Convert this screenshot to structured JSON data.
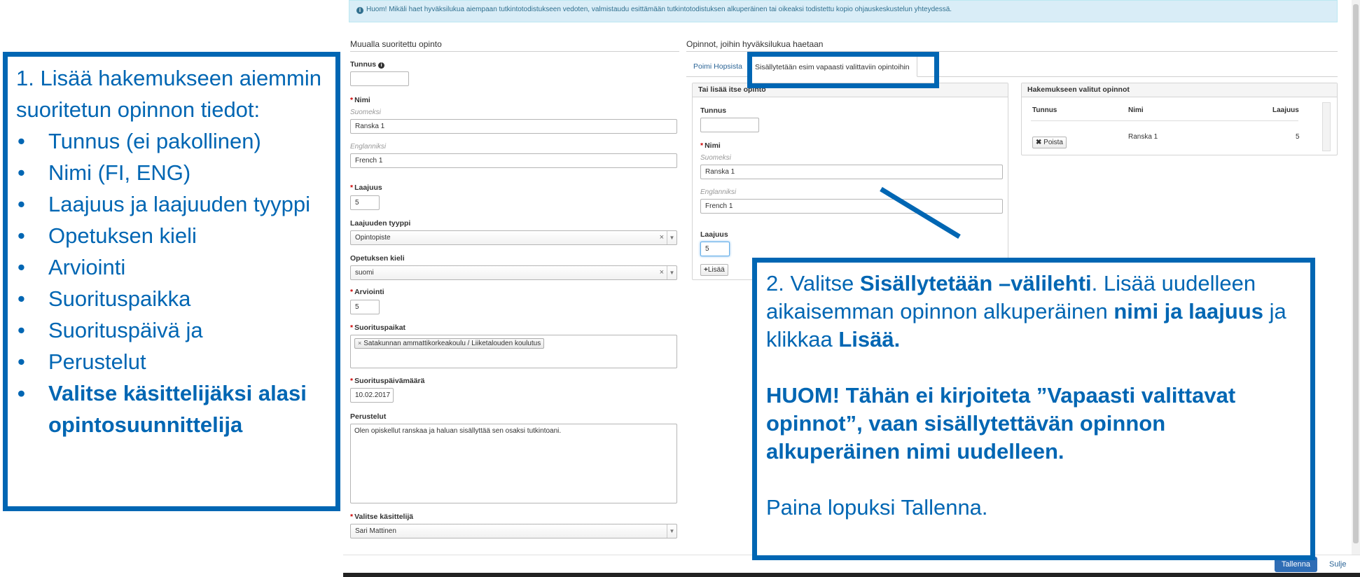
{
  "notice": {
    "icon": "info-circle-icon",
    "text": "Huom! Mikäli haet hyväksilukua aiempaan tutkintotodistukseen vedoten, valmistaudu esittämään tutkintotodistuksen alkuperäinen tai oikeaksi todistettu kopio ohjauskeskustelun yhteydessä."
  },
  "left_form": {
    "title": "Muualla suoritettu opinto",
    "tunnus_label": "Tunnus",
    "tunnus_value": "",
    "nimi_label": "Nimi",
    "suomeksi_label": "Suomeksi",
    "nimi_fi": "Ranska 1",
    "englanniksi_label": "Englanniksi",
    "nimi_en": "French 1",
    "laajuus_label": "Laajuus",
    "laajuus_value": "5",
    "laajuuden_tyyppi_label": "Laajuuden tyyppi",
    "laajuuden_tyyppi_value": "Opintopiste",
    "opetuksen_kieli_label": "Opetuksen kieli",
    "opetuksen_kieli_value": "suomi",
    "arviointi_label": "Arviointi",
    "arviointi_value": "5",
    "suorituspaikat_label": "Suorituspaikat",
    "suorituspaikka_chip": "Satakunnan ammattikorkeakoulu / Liiketalouden koulutus",
    "suorituspaivamaara_label": "Suorituspäivämäärä",
    "suorituspaivamaara_value": "10.02.2017",
    "perustelut_label": "Perustelut",
    "perustelut_value": "Olen opiskellut ranskaa ja haluan sisällyttää sen osaksi tutkintoani.",
    "kasittelija_label": "Valitse käsittelijä",
    "kasittelija_value": "Sari Mattinen",
    "required_mark": "*",
    "clear_mark": "×",
    "caret": "▼"
  },
  "right_area": {
    "title": "Opinnot, joihin hyväksilukua haetaan",
    "tabs": [
      {
        "label": "Poimi Hopsista",
        "active": false
      },
      {
        "label": "Sisällytetään esim vapaasti valittaviin opintoihin",
        "active": true
      }
    ],
    "own_panel": {
      "title": "Tai lisää itse opinto",
      "tunnus_label": "Tunnus",
      "tunnus_value": "",
      "nimi_label": "Nimi",
      "suomeksi_label": "Suomeksi",
      "nimi_fi": "Ranska 1",
      "englanniksi_label": "Englanniksi",
      "nimi_en": "French 1",
      "laajuus_label": "Laajuus",
      "laajuus_value": "5",
      "add_button": "Lisää",
      "add_icon": "plus-icon"
    },
    "selected_panel": {
      "title": "Hakemukseen valitut opinnot",
      "columns": [
        "Tunnus",
        "Nimi",
        "Laajuus"
      ],
      "rows": [
        {
          "tunnus": "",
          "nimi": "Ranska 1",
          "laajuus": "5",
          "remove_label": "Poista"
        }
      ]
    }
  },
  "footer": {
    "save_label": "Tallenna",
    "close_label": "Sulje"
  },
  "callout1": {
    "intro": "1. Lisää hakemukseen aiemmin suoritetun opinnon tiedot:",
    "items": [
      "Tunnus (ei  pakollinen)",
      "Nimi (FI, ENG)",
      "Laajuus ja laajuuden tyyppi",
      "Opetuksen kieli",
      "Arviointi",
      "Suorituspaikka",
      "Suorituspäivä ja",
      "Perustelut"
    ],
    "last_item": "Valitse käsittelijäksi alasi opintosuunnittelija"
  },
  "callout2": {
    "p1_a": "2. Valitse ",
    "p1_b": "Sisällytetään –välilehti",
    "p1_c": ". Lisää uudelleen aikaisemman opinnon alkuperäinen ",
    "p1_d": "nimi ja laajuus",
    "p1_e": " ja klikkaa ",
    "p1_f": "Lisää.",
    "p2": "HUOM! Tähän ei kirjoiteta ”Vapaasti valittavat opinnot”, vaan sisällytettävän opinnon alkuperäinen nimi uudelleen.",
    "p3": "Paina lopuksi Tallenna."
  },
  "colors": {
    "callout_blue": "#0066b3",
    "notice_bg": "#d9edf7",
    "primary_button": "#2f6db5",
    "required": "#cc0000"
  }
}
